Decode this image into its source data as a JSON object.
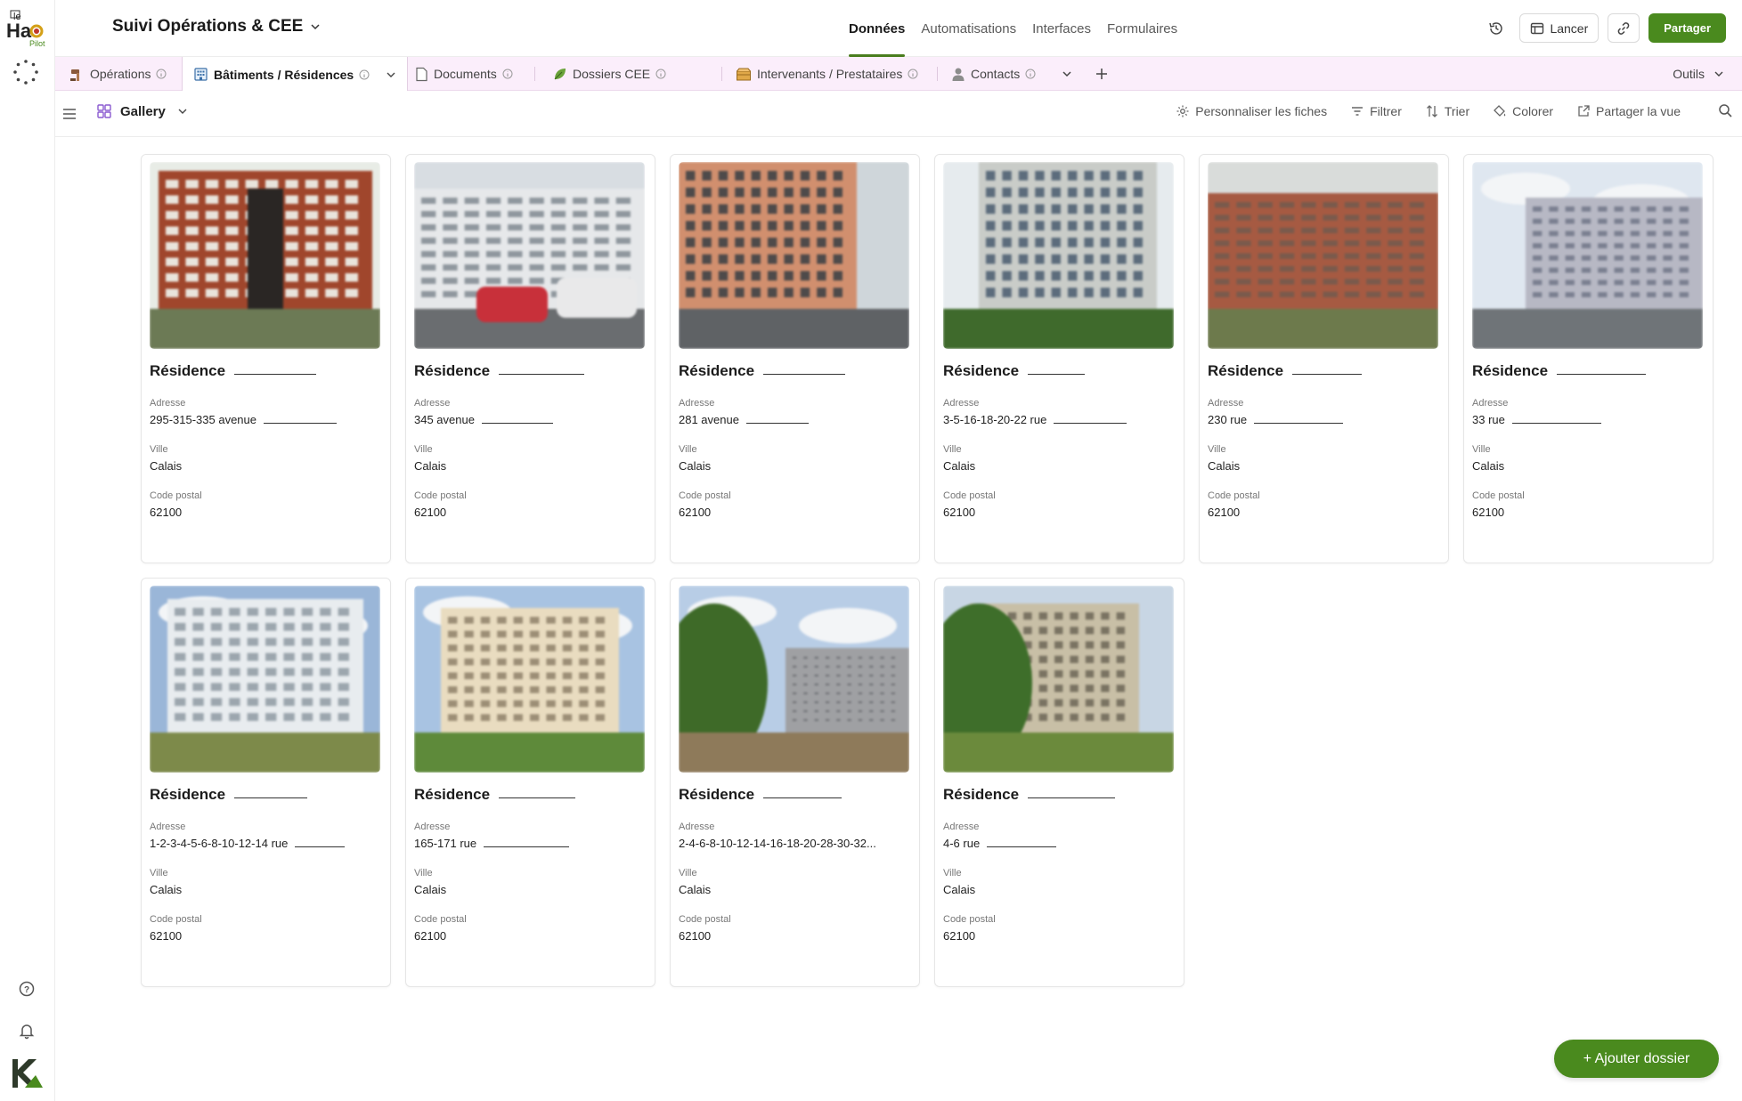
{
  "app": {
    "base_title": "Suivi Opérations & CEE",
    "logo_text": "le Halo Pilot"
  },
  "topnav": [
    {
      "label": "Données",
      "active": true
    },
    {
      "label": "Automatisations",
      "active": false
    },
    {
      "label": "Interfaces",
      "active": false
    },
    {
      "label": "Formulaires",
      "active": false
    }
  ],
  "top_actions": {
    "launch_label": "Lancer",
    "share_label": "Partager"
  },
  "tabs": [
    {
      "label": "Opérations",
      "icon": "hammer-icon"
    },
    {
      "label": "Bâtiments / Résidences",
      "icon": "building-icon",
      "active": true
    },
    {
      "label": "Documents",
      "icon": "document-icon"
    },
    {
      "label": "Dossiers CEE",
      "icon": "leaf-icon"
    },
    {
      "label": "Intervenants / Prestataires",
      "icon": "crate-icon"
    },
    {
      "label": "Contacts",
      "icon": "person-icon"
    }
  ],
  "tools_label": "Outils",
  "view": {
    "name": "Gallery",
    "actions": {
      "customize": "Personnaliser les fiches",
      "filter": "Filtrer",
      "sort": "Trier",
      "color": "Colorer",
      "share_view": "Partager la vue"
    }
  },
  "fields": {
    "address_label": "Adresse",
    "city_label": "Ville",
    "postal_label": "Code postal"
  },
  "cards": [
    {
      "title": "Résidence",
      "address": "295-315-335 avenue",
      "city": "Calais",
      "postal": "62100",
      "redact_title": 92,
      "redact_addr": 82
    },
    {
      "title": "Résidence",
      "address": "345 avenue",
      "city": "Calais",
      "postal": "62100",
      "redact_title": 96,
      "redact_addr": 80
    },
    {
      "title": "Résidence",
      "address": "281 avenue",
      "city": "Calais",
      "postal": "62100",
      "redact_title": 92,
      "redact_addr": 70
    },
    {
      "title": "Résidence",
      "address": "3-5-16-18-20-22 rue",
      "city": "Calais",
      "postal": "62100",
      "redact_title": 64,
      "redact_addr": 82
    },
    {
      "title": "Résidence",
      "address": "230 rue",
      "city": "Calais",
      "postal": "62100",
      "redact_title": 78,
      "redact_addr": 100
    },
    {
      "title": "Résidence",
      "address": "33 rue",
      "city": "Calais",
      "postal": "62100",
      "redact_title": 100,
      "redact_addr": 100
    },
    {
      "title": "Résidence",
      "address": "1-2-3-4-5-6-8-10-12-14 rue",
      "city": "Calais",
      "postal": "62100",
      "redact_title": 82,
      "redact_addr": 56
    },
    {
      "title": "Résidence",
      "address": "165-171 rue",
      "city": "Calais",
      "postal": "62100",
      "redact_title": 86,
      "redact_addr": 96
    },
    {
      "title": "Résidence",
      "address": "2-4-6-8-10-12-14-16-18-20-28-30-32...",
      "city": "Calais",
      "postal": "62100",
      "redact_title": 88,
      "redact_addr": 0
    },
    {
      "title": "Résidence",
      "address": "4-6 rue",
      "city": "Calais",
      "postal": "62100",
      "redact_title": 98,
      "redact_addr": 78
    }
  ],
  "add_button_label": "+ Ajouter dossier",
  "colors": {
    "accent": "#4a8a1e",
    "tabs_bg": "#fbeefb"
  }
}
